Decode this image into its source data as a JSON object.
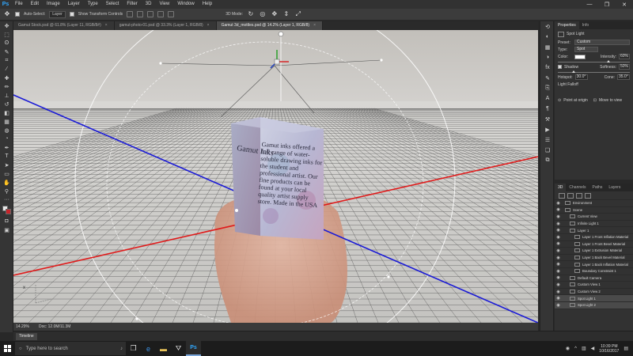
{
  "app": {
    "logo": "Ps"
  },
  "menu": [
    "File",
    "Edit",
    "Image",
    "Layer",
    "Type",
    "Select",
    "Filter",
    "3D",
    "View",
    "Window",
    "Help"
  ],
  "window_controls": [
    "—",
    "❐",
    "✕"
  ],
  "options_bar": {
    "auto_select_label": "Auto-Select:",
    "auto_select_value": "Layer",
    "transform_label": "Show Transform Controls",
    "mode_label": "3D Mode:"
  },
  "tabs": [
    {
      "label": "Gamut Stock.psd @ 61.8% (Layer 11, RGB/8#)",
      "active": false
    },
    {
      "label": "gamut-photo-01.psd @ 33.3% (Layer 1, RGB/8)",
      "active": false
    },
    {
      "label": "Gamut 3d_mottles.psd @ 14.2% (Layer 1, RGB/8)",
      "active": true
    }
  ],
  "box_text": "Gamut inks offered a full range of water- soluble drawing inks for the student and professional artist. Our fine products can be found at your local quality artist supply store. Made in the USA",
  "box_title": "Gamut Inks",
  "axis_gizmo_label": "x",
  "status": {
    "zoom": "14.29%",
    "doc": "Doc: 12.0M/11.3M"
  },
  "timeline": {
    "label": "Timeline"
  },
  "properties": {
    "tabs": [
      "Properties",
      "Info"
    ],
    "title": "Spot Light",
    "preset_label": "Preset:",
    "preset_value": "Custom",
    "type_label": "Type:",
    "type_value": "Spot",
    "color_label": "Color:",
    "intensity_label": "Intensity:",
    "intensity_value": "60%",
    "shadow_label": "Shadow",
    "softness_label": "Softness:",
    "softness_value": "50%",
    "hotspot_label": "Hotspot:",
    "hotspot_value": "30.0°",
    "cone_label": "Cone:",
    "cone_value": "35.0°",
    "falloff_label": "Light Falloff",
    "point_label": "Point at origin",
    "move_label": "Move to view"
  },
  "panel3d": {
    "tabs": [
      "3D",
      "Channels",
      "Paths",
      "Layers"
    ],
    "rows": [
      {
        "label": "Environment",
        "indent": 0,
        "selected": false
      },
      {
        "label": "Scene",
        "indent": 0,
        "selected": false
      },
      {
        "label": "Current View",
        "indent": 1,
        "selected": false
      },
      {
        "label": "Infinite Light 1",
        "indent": 1,
        "selected": false
      },
      {
        "label": "Layer 1",
        "indent": 1,
        "selected": false
      },
      {
        "label": "Layer 1 Front Inflation Material",
        "indent": 2,
        "selected": false
      },
      {
        "label": "Layer 1 Front Bevel Material",
        "indent": 2,
        "selected": false
      },
      {
        "label": "Layer 1 Extrusion Material",
        "indent": 2,
        "selected": false
      },
      {
        "label": "Layer 1 Back Bevel Material",
        "indent": 2,
        "selected": false
      },
      {
        "label": "Layer 1 Back Inflation Material",
        "indent": 2,
        "selected": false
      },
      {
        "label": "Boundary Constraint 1",
        "indent": 2,
        "selected": false
      },
      {
        "label": "Default Camera",
        "indent": 1,
        "selected": false
      },
      {
        "label": "Custom View 1",
        "indent": 1,
        "selected": false
      },
      {
        "label": "Custom View 2",
        "indent": 1,
        "selected": false
      },
      {
        "label": "Spot Light 1",
        "indent": 1,
        "selected": true
      },
      {
        "label": "Spot Light 2",
        "indent": 1,
        "selected": true
      }
    ]
  },
  "taskbar": {
    "search_placeholder": "Type here to search",
    "time": "10:39 PM",
    "date": "10/16/2017"
  }
}
